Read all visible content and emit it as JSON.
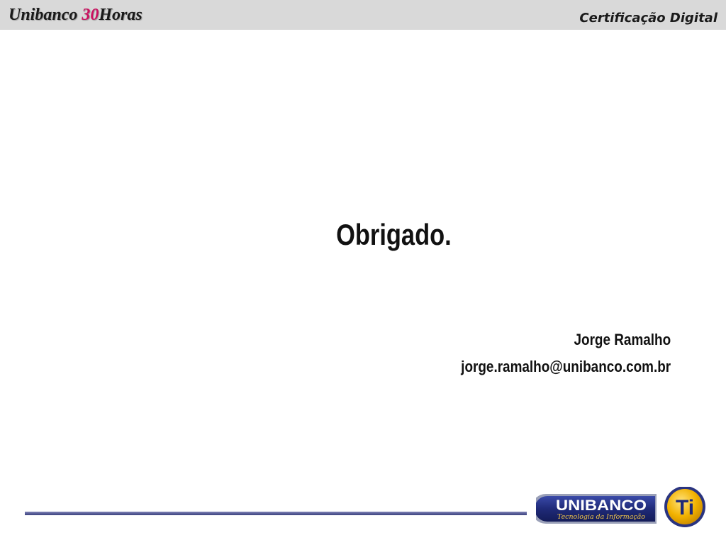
{
  "header": {
    "brand": {
      "prefix": "Unibanco ",
      "number": "30",
      "suffix": "Horas"
    },
    "section": "Certificação Digital"
  },
  "slide": {
    "title": "Obrigado.",
    "contact": {
      "name": "Jorge Ramalho",
      "email": "jorge.ramalho@unibanco.com.br"
    }
  },
  "footer": {
    "logo": {
      "wordmark": "UNIBANCO",
      "tagline": "Tecnologia da Informação",
      "badge": "Ti"
    }
  },
  "colors": {
    "header_band": "#d9d9d9",
    "brand_number": "#cc1060",
    "footer_line": "#5a5f98",
    "logo_navy": "#1f2a78",
    "logo_gold": "#f2b200"
  }
}
